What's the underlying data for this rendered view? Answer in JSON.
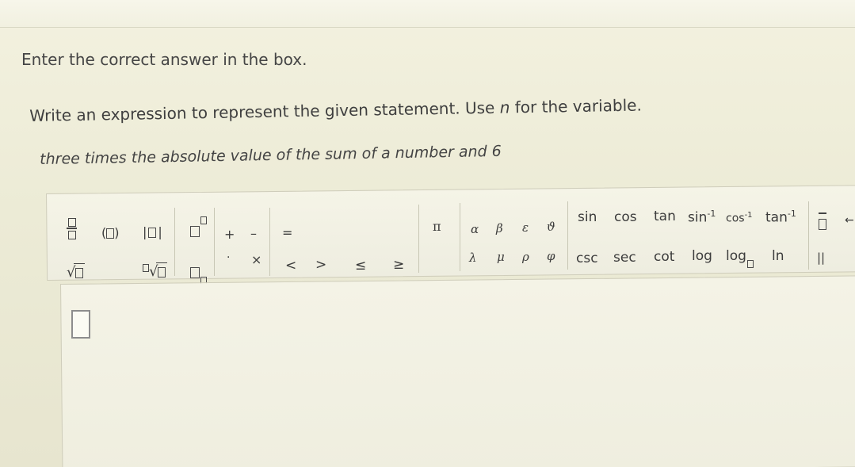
{
  "instructions": "Enter the correct answer in the box.",
  "prompt_before": "Write an expression to represent the given statement. Use ",
  "prompt_var": "n",
  "prompt_after": " for the variable.",
  "statement": "three times the absolute value of the sum of a number and 6",
  "toolbar": {
    "paren": "(",
    "paren_close": ")",
    "abs_left": "|",
    "abs_right": "|",
    "plus": "+",
    "minus": "–",
    "equals": "=",
    "dot": "·",
    "times": "×",
    "lt": "<",
    "gt": ">",
    "le": "≤",
    "ge": "≥",
    "pi": "π",
    "greek_row1": [
      "α",
      "β",
      "ε",
      "ϑ"
    ],
    "greek_row2": [
      "λ",
      "μ",
      "ρ",
      "φ"
    ],
    "trig_row1": [
      "sin",
      "cos",
      "tan",
      "sin",
      "cos",
      "tan"
    ],
    "inv_sup": "-1",
    "trig_row2": [
      "csc",
      "sec",
      "cot",
      "log",
      "log",
      "ln"
    ],
    "parallel": "||",
    "arrow": "←"
  }
}
